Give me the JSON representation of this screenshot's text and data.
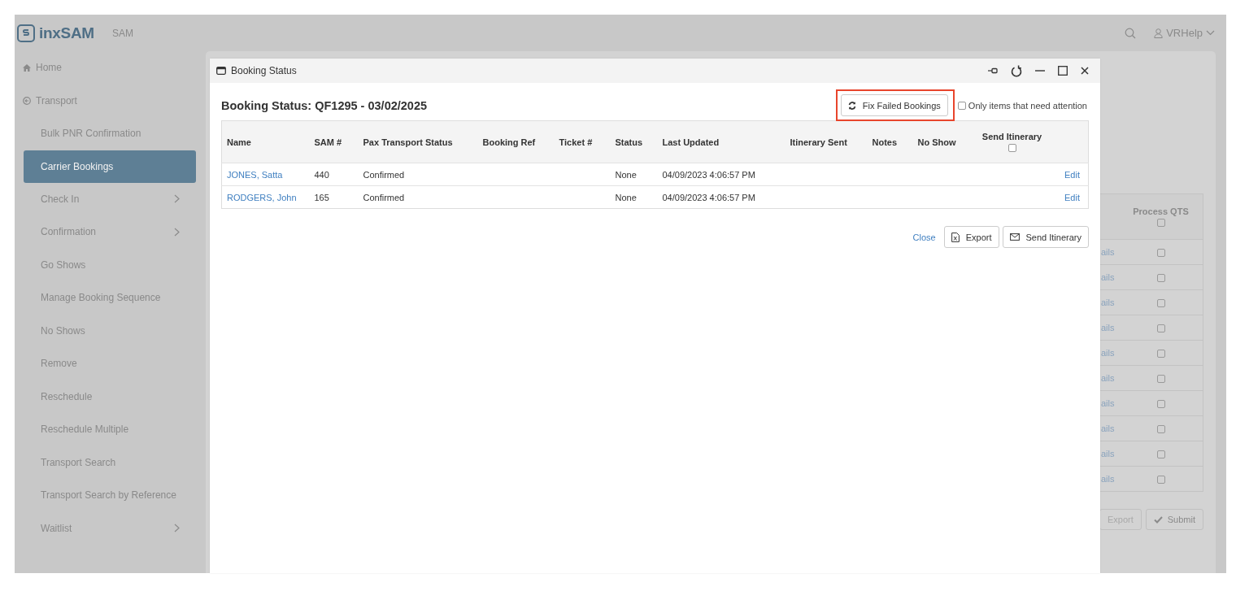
{
  "header": {
    "logo": "inxSAM",
    "app_name": "SAM",
    "user": "VRHelp"
  },
  "sidebar": {
    "items": [
      {
        "label": "Home",
        "kind": "home",
        "selected": false,
        "expandable": false
      },
      {
        "label": "Transport",
        "kind": "section",
        "selected": false,
        "expandable": false
      },
      {
        "label": "Bulk PNR Confirmation",
        "kind": "link",
        "selected": false,
        "expandable": false
      },
      {
        "label": "Carrier Bookings",
        "kind": "link",
        "selected": true,
        "expandable": false
      },
      {
        "label": "Check In",
        "kind": "link",
        "selected": false,
        "expandable": true
      },
      {
        "label": "Confirmation",
        "kind": "link",
        "selected": false,
        "expandable": true
      },
      {
        "label": "Go Shows",
        "kind": "link",
        "selected": false,
        "expandable": false
      },
      {
        "label": "Manage Booking Sequence",
        "kind": "link",
        "selected": false,
        "expandable": false
      },
      {
        "label": "No Shows",
        "kind": "link",
        "selected": false,
        "expandable": false
      },
      {
        "label": "Remove",
        "kind": "link",
        "selected": false,
        "expandable": false
      },
      {
        "label": "Reschedule",
        "kind": "link",
        "selected": false,
        "expandable": false
      },
      {
        "label": "Reschedule Multiple",
        "kind": "link",
        "selected": false,
        "expandable": false
      },
      {
        "label": "Transport Search",
        "kind": "link",
        "selected": false,
        "expandable": false
      },
      {
        "label": "Transport Search by Reference",
        "kind": "link",
        "selected": false,
        "expandable": false
      },
      {
        "label": "Waitlist",
        "kind": "link",
        "selected": false,
        "expandable": true
      }
    ]
  },
  "background_table": {
    "column": "Process QTS",
    "header_checked": false,
    "rows": [
      {
        "link": "ails",
        "checked": false
      },
      {
        "link": "ails",
        "checked": false
      },
      {
        "link": "ails",
        "checked": false
      },
      {
        "link": "ails",
        "checked": false
      },
      {
        "link": "ails",
        "checked": false
      },
      {
        "link": "ails",
        "checked": false
      },
      {
        "link": "ails",
        "checked": false
      },
      {
        "link": "ails",
        "checked": false
      },
      {
        "link": "ails",
        "checked": false
      },
      {
        "link": "ails",
        "checked": false
      }
    ],
    "buttons": [
      {
        "label": "Export",
        "kind": "export",
        "disabled": true
      },
      {
        "label": "Submit",
        "kind": "submit",
        "disabled": false
      }
    ]
  },
  "dialog": {
    "title": "Booking Status",
    "heading": "Booking Status: QF1295 - 03/02/2025",
    "fix_button": {
      "label": "Fix Failed Bookings",
      "highlighted": true
    },
    "filter": {
      "label": "Only items that need attention",
      "checked": false
    },
    "table": {
      "columns": [
        "Name",
        "SAM #",
        "Pax Transport Status",
        "Booking Ref",
        "Ticket #",
        "Status",
        "Last Updated",
        "Itinerary Sent",
        "Notes",
        "No Show",
        "Send Itinerary"
      ],
      "send_itinerary_all_checked": false,
      "rows": [
        {
          "name": "JONES, Satta",
          "sam": "440",
          "pax_transport_status": "Confirmed",
          "status": "None",
          "last_updated": "04/09/2023 4:06:57 PM",
          "action": "Edit"
        },
        {
          "name": "RODGERS, John",
          "sam": "165",
          "pax_transport_status": "Confirmed",
          "status": "None",
          "last_updated": "04/09/2023 4:06:57 PM",
          "action": "Edit"
        }
      ]
    },
    "footer": {
      "close": "Close",
      "export": "Export",
      "send": "Send Itinerary"
    }
  }
}
